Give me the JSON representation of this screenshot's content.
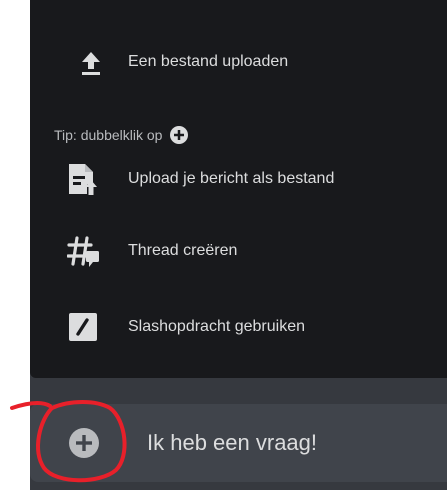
{
  "attach_menu": {
    "upload_file_label": "Een bestand uploaden",
    "tip_text": "Tip: dubbelklik op",
    "upload_message_label": "Upload je bericht als bestand",
    "create_thread_label": "Thread creëren",
    "slash_command_label": "Slashopdracht gebruiken"
  },
  "composer": {
    "placeholder": "Ik heb een vraag!"
  },
  "icons": {
    "upload_file": "upload-arrow-icon",
    "tip_plus": "plus-circle-icon",
    "upload_message": "file-upload-icon",
    "create_thread": "thread-hash-icon",
    "slash_command": "slash-box-icon",
    "add_attachment": "plus-circle-icon"
  },
  "colors": {
    "popup_background": "#18191c",
    "composer_background": "#40444b",
    "annotation_red": "#e8202a"
  }
}
